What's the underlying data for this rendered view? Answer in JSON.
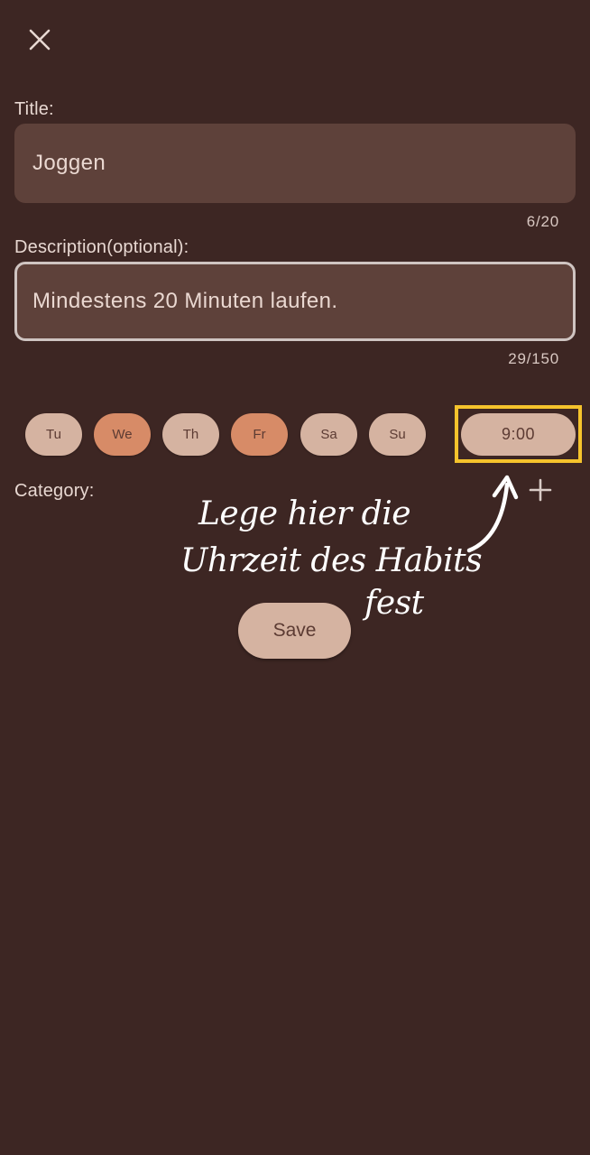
{
  "header": {
    "close_icon": "close-icon"
  },
  "form": {
    "title_label": "Title:",
    "title_value": "Joggen",
    "title_counter": "6/20",
    "description_label": "Description(optional):",
    "description_value": "Mindestens 20 Minuten laufen.",
    "description_counter": "29/150",
    "days": [
      {
        "label": "Tu",
        "selected": false
      },
      {
        "label": "We",
        "selected": true
      },
      {
        "label": "Th",
        "selected": false
      },
      {
        "label": "Fr",
        "selected": true
      },
      {
        "label": "Sa",
        "selected": false
      },
      {
        "label": "Su",
        "selected": false
      }
    ],
    "time_value": "9:00",
    "category_label": "Category:",
    "add_icon": "plus-icon",
    "save_label": "Save"
  },
  "annotation": {
    "line1": "Lege hier die",
    "line2": "Uhrzeit des Habits",
    "line3": "fest",
    "highlight_color": "#f5c32c"
  },
  "colors": {
    "background": "#3d2623",
    "field": "#5e413a",
    "chip": "#d5b3a1",
    "chip_selected": "#d78b67"
  }
}
